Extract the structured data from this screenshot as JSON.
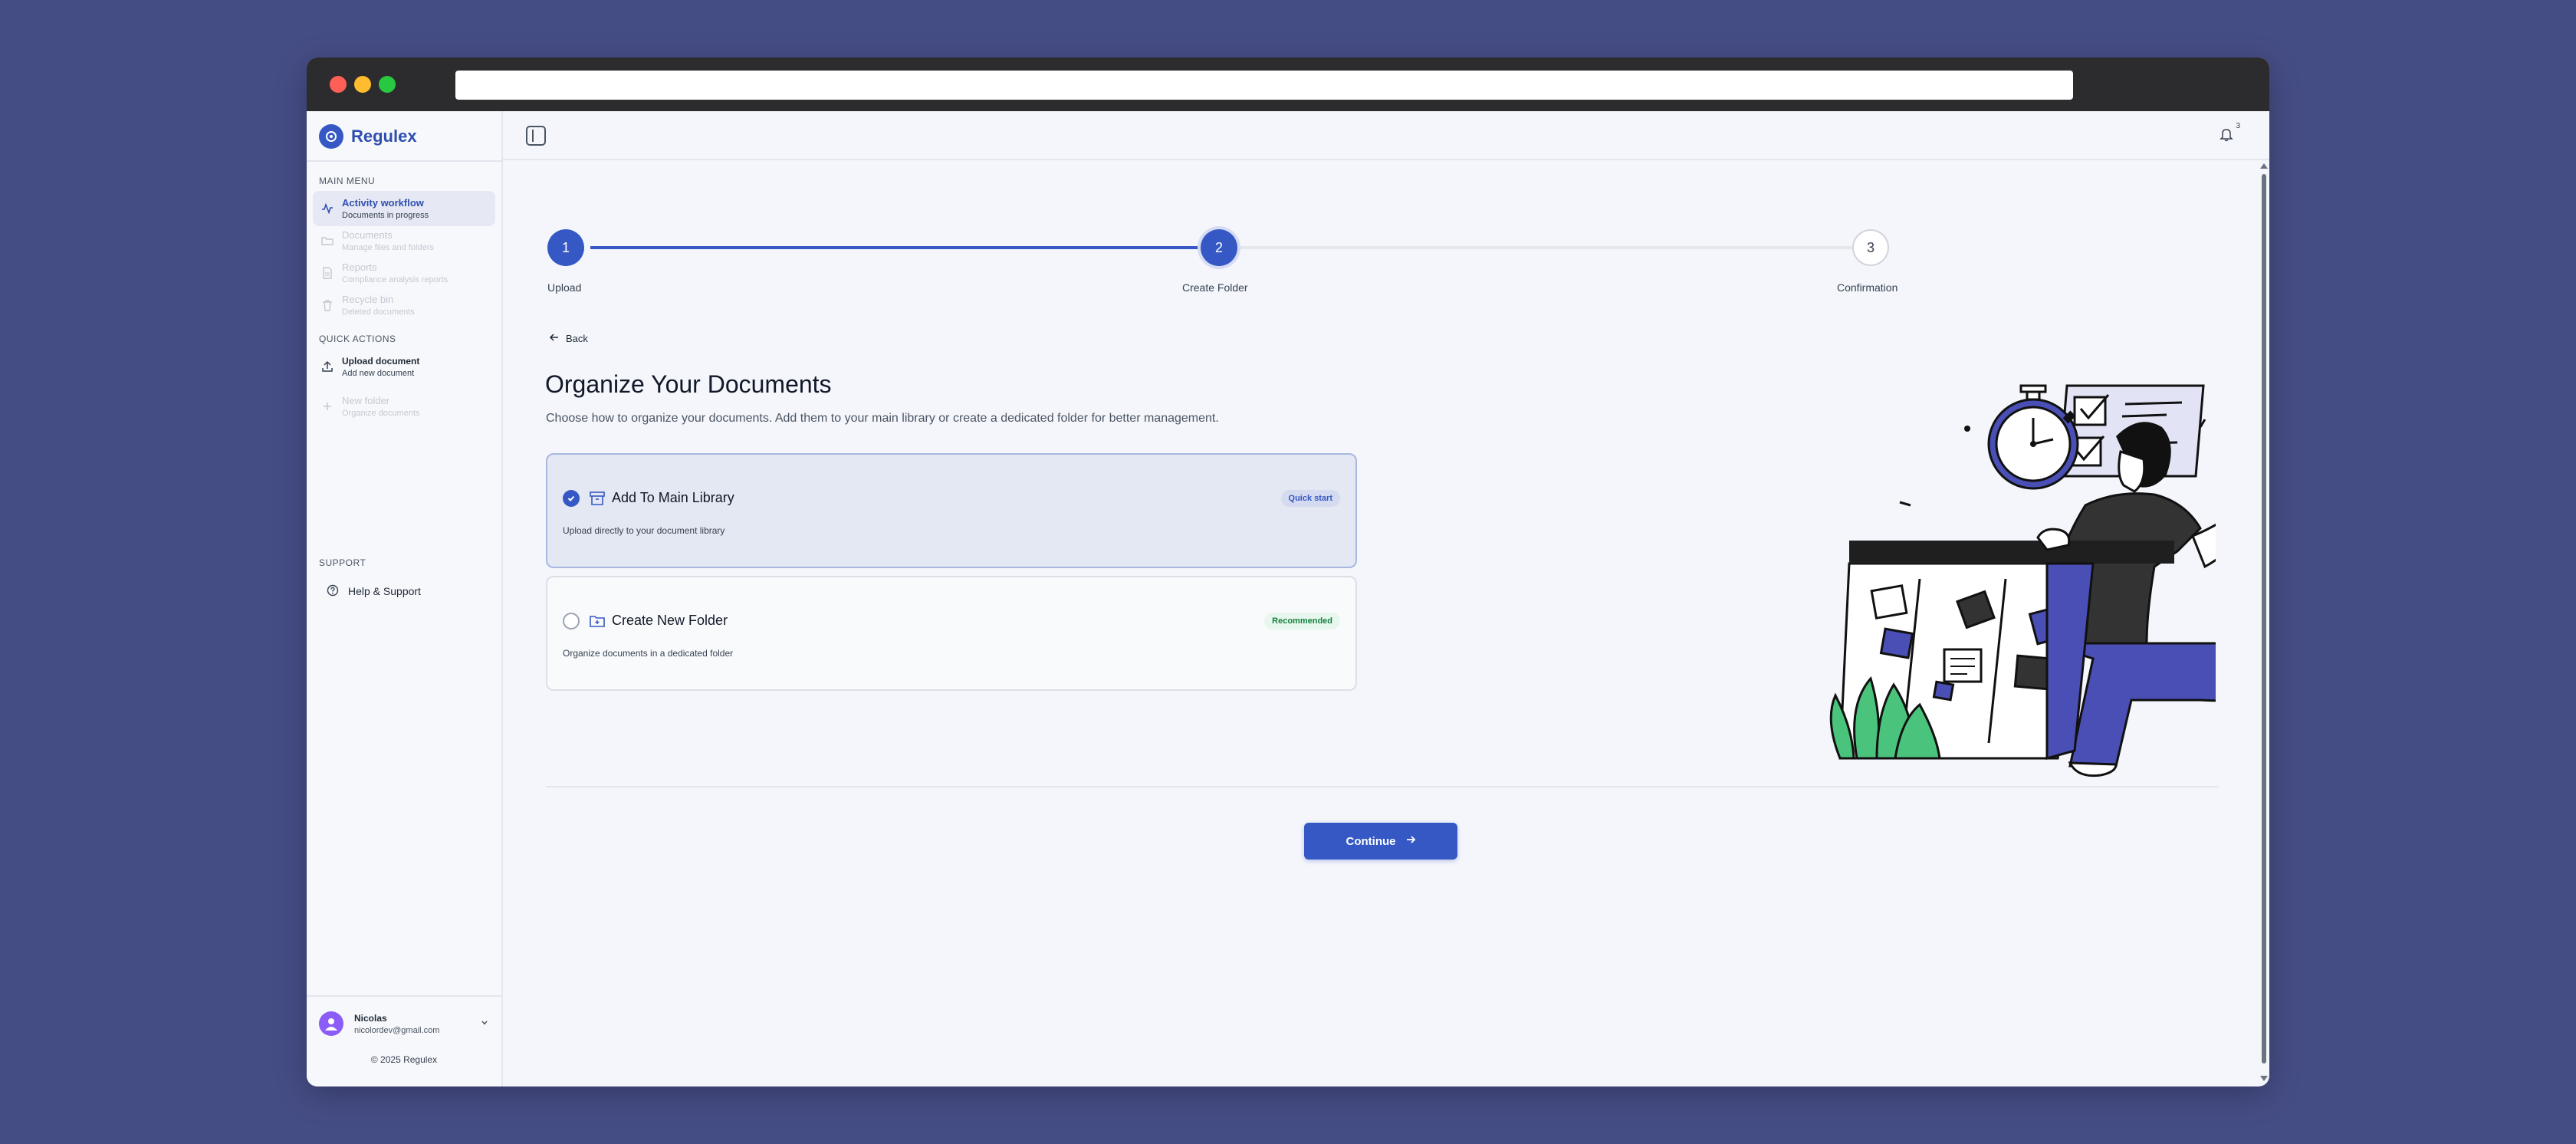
{
  "app": {
    "name": "Regulex",
    "copyright": "© 2025 Regulex"
  },
  "sidebar": {
    "main_menu_title": "MAIN MENU",
    "main_items": [
      {
        "label": "Activity workflow",
        "sub": "Documents in progress",
        "state": "active"
      },
      {
        "label": "Documents",
        "sub": "Manage files and folders",
        "state": "disabled"
      },
      {
        "label": "Reports",
        "sub": "Compliance analysis reports",
        "state": "disabled"
      },
      {
        "label": "Recycle bin",
        "sub": "Deleted documents",
        "state": "disabled"
      }
    ],
    "quick_actions_title": "QUICK ACTIONS",
    "quick_items": [
      {
        "label": "Upload document",
        "sub": "Add new document",
        "state": "enabled"
      },
      {
        "label": "New folder",
        "sub": "Organize documents",
        "state": "disabled"
      }
    ],
    "support_title": "SUPPORT",
    "help_label": "Help & Support",
    "user": {
      "name": "Nicolas",
      "email": "nicolordev@gmail.com"
    }
  },
  "topbar": {
    "notification_count": "3"
  },
  "stepper": {
    "steps": [
      {
        "number": "1",
        "label": "Upload",
        "status": "done"
      },
      {
        "number": "2",
        "label": "Create Folder",
        "status": "current"
      },
      {
        "number": "3",
        "label": "Confirmation",
        "status": "todo"
      }
    ]
  },
  "main": {
    "back_label": "Back",
    "title": "Organize Your Documents",
    "description": "Choose how to organize your documents. Add them to your main library or create a dedicated folder for better management.",
    "options": [
      {
        "title": "Add To Main Library",
        "desc": "Upload directly to your document library",
        "badge": "Quick start",
        "selected": true,
        "icon": "archive-icon"
      },
      {
        "title": "Create New Folder",
        "desc": "Organize documents in a dedicated folder",
        "badge": "Recommended",
        "selected": false,
        "icon": "folder-plus-icon"
      }
    ],
    "continue_label": "Continue"
  },
  "colors": {
    "accent": "#3558c4",
    "background": "#454d85",
    "success": "#15803d",
    "illustration_accent": "#4a4fb5"
  }
}
